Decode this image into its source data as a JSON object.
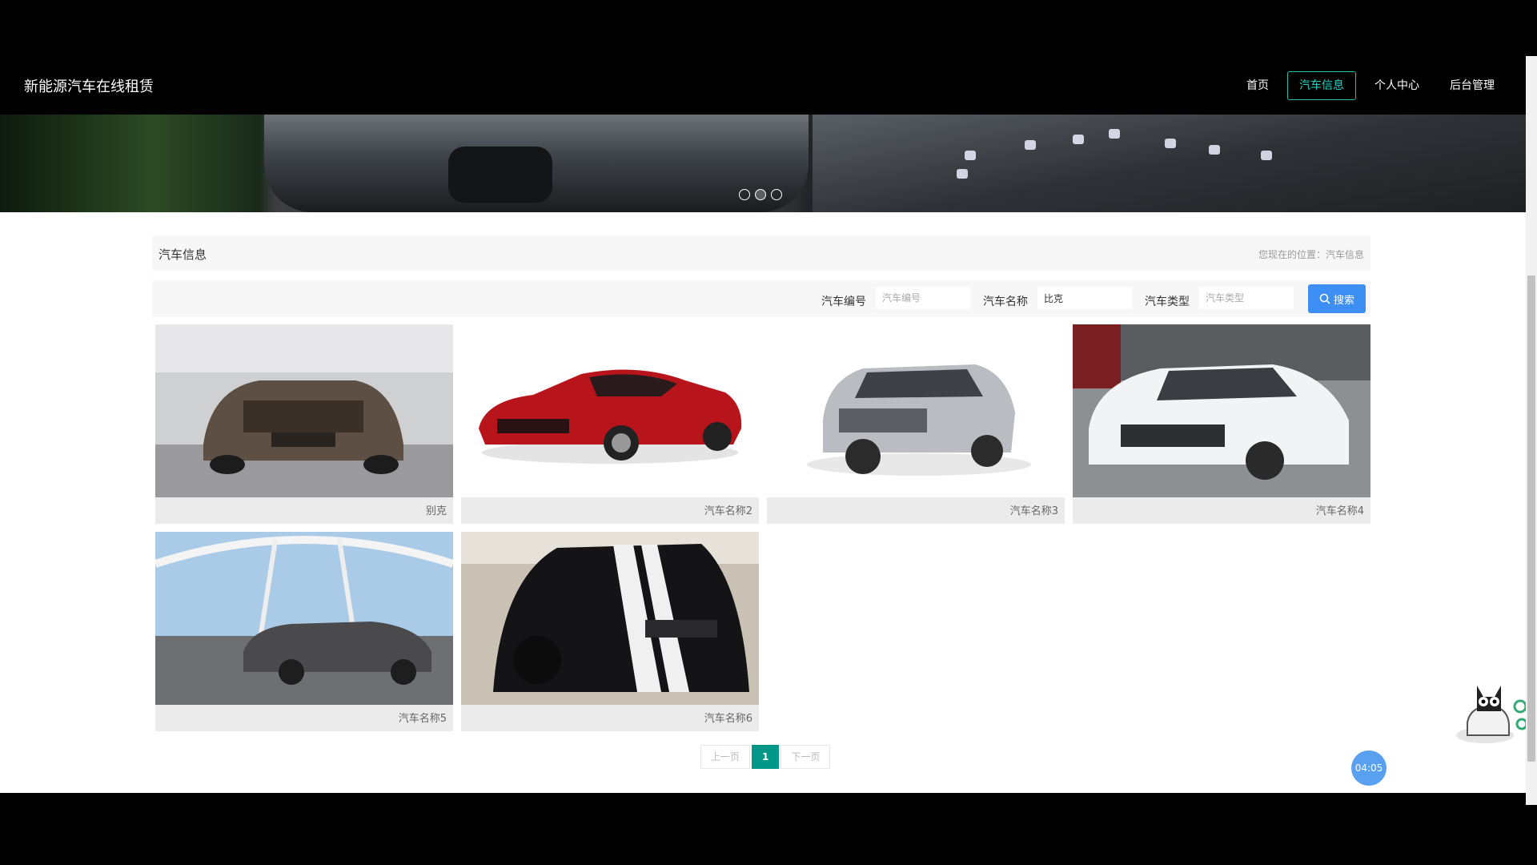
{
  "app": {
    "brand": "新能源汽车在线租赁"
  },
  "nav": [
    {
      "label": "首页",
      "active": false
    },
    {
      "label": "汽车信息",
      "active": true
    },
    {
      "label": "个人中心",
      "active": false
    },
    {
      "label": "后台管理",
      "active": false
    }
  ],
  "banner": {
    "slide_count": 3,
    "active_slide": 2
  },
  "section": {
    "title": "汽车信息",
    "location": "您现在的位置：汽车信息"
  },
  "search": {
    "fields": [
      {
        "label": "汽车编号",
        "value": "",
        "placeholder": "汽车编号"
      },
      {
        "label": "汽车名称",
        "value": "比克",
        "placeholder": "汽车名称"
      },
      {
        "label": "汽车类型",
        "value": "",
        "placeholder": "汽车类型"
      }
    ],
    "button_label": "搜索",
    "button_icon": "search-icon"
  },
  "cars": [
    {
      "name": "别克",
      "image": "brown-sedan-showroom-photo"
    },
    {
      "name": "汽车名称2",
      "image": "red-sedan-photo"
    },
    {
      "name": "汽车名称3",
      "image": "silver-suv-photo"
    },
    {
      "name": "汽车名称4",
      "image": "white-sedan-photo"
    },
    {
      "name": "汽车名称5",
      "image": "grey-sedan-bridge-photo"
    },
    {
      "name": "汽车名称6",
      "image": "black-muscle-car-photo"
    }
  ],
  "pagination": {
    "prev": "上一页",
    "current": "1",
    "next": "下一页"
  },
  "widgets": {
    "timer": "04:05",
    "mascot_icon": "cartoon-mascot-icon"
  },
  "colors": {
    "accent": "#009688",
    "nav_active": "#2bbfb0",
    "search_button": "#3d8ef5"
  }
}
